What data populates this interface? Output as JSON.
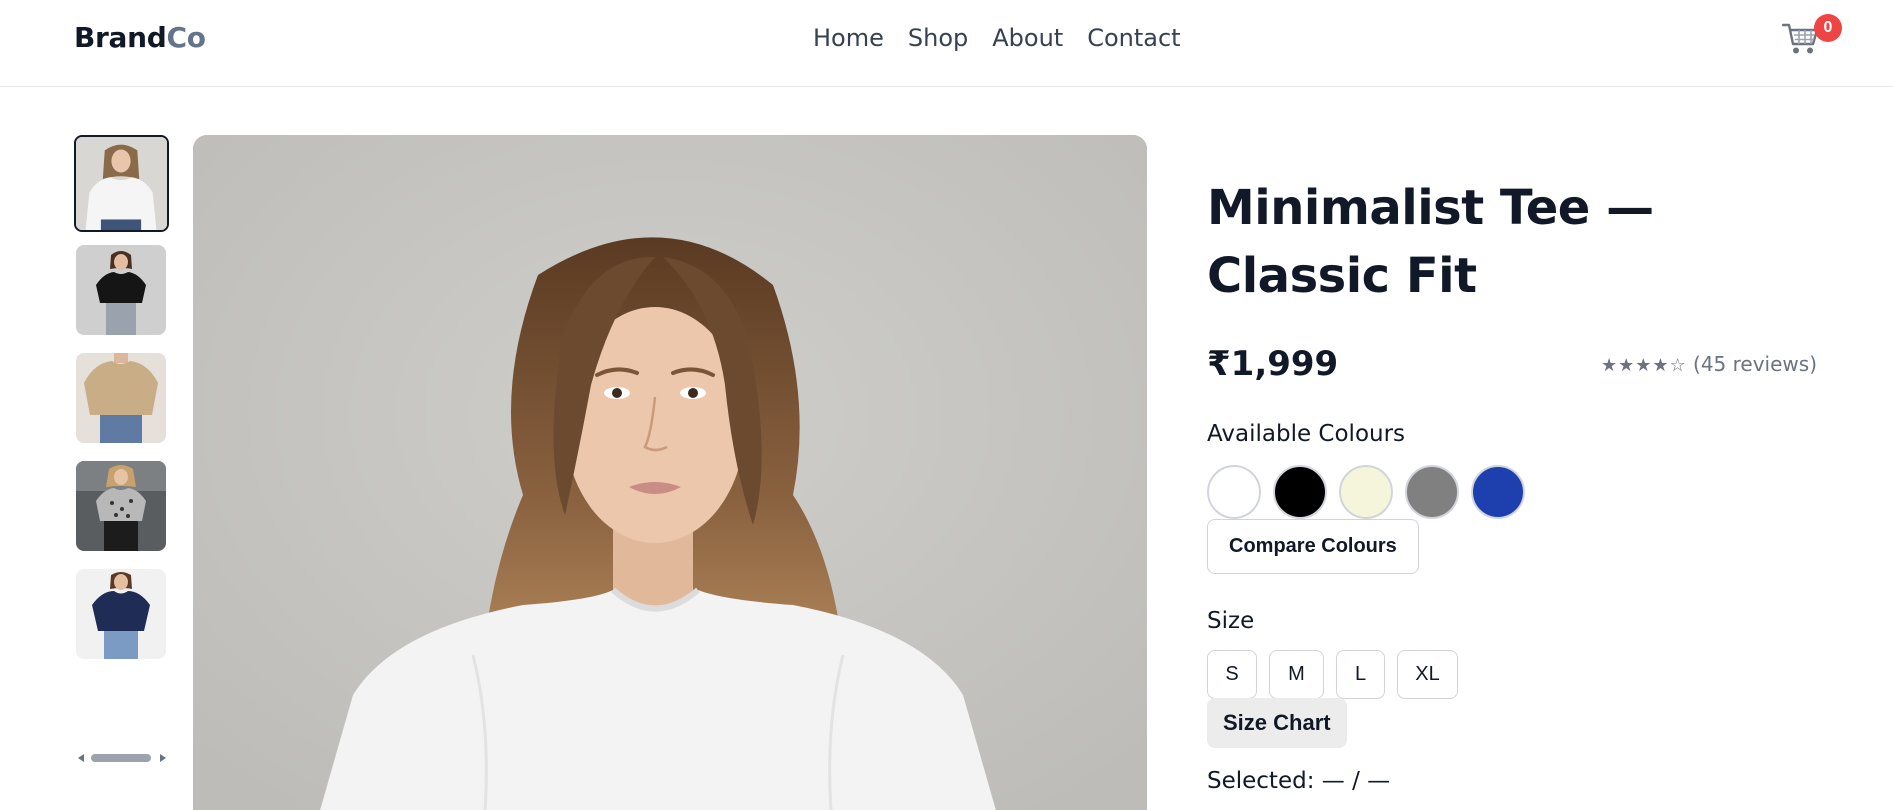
{
  "header": {
    "logo_part1": "Brand",
    "logo_part2": "Co",
    "nav": [
      "Home",
      "Shop",
      "About",
      "Contact"
    ],
    "cart_count": "0",
    "cart_icon": "shopping-cart-icon"
  },
  "gallery": {
    "thumbnails": [
      {
        "alt": "white tee",
        "shirt_color": "#f5f5f5",
        "bg": "#d9d7d3",
        "active": true
      },
      {
        "alt": "black tee",
        "shirt_color": "#151515",
        "bg": "#cfcfcf",
        "active": false
      },
      {
        "alt": "beige tee",
        "shirt_color": "#c9ad86",
        "bg": "#e6e0da",
        "active": false
      },
      {
        "alt": "patterned tee",
        "shirt_color": "#9a9a9a",
        "bg": "#5a5d60",
        "active": false
      },
      {
        "alt": "navy tee",
        "shirt_color": "#1f2c55",
        "bg": "#f1f1f1",
        "active": false
      }
    ]
  },
  "product": {
    "title": "Minimalist Tee — Classic Fit",
    "price": "₹1,999",
    "rating_stars": "★★★★☆",
    "reviews": "(45 reviews)",
    "rating_value": 4,
    "rating_max": 5,
    "colours_label": "Available Colours",
    "colours": [
      "#ffffff",
      "#000000",
      "#f5f5dc",
      "#808080",
      "#1e40af"
    ],
    "compare_label": "Compare Colours",
    "size_label": "Size",
    "sizes": [
      "S",
      "M",
      "L",
      "XL"
    ],
    "size_chart_label": "Size Chart",
    "selected_text": "Selected: — / —"
  },
  "colors": {
    "accent_badge": "#ef4444",
    "text": "#111827",
    "muted": "#6b7280"
  }
}
